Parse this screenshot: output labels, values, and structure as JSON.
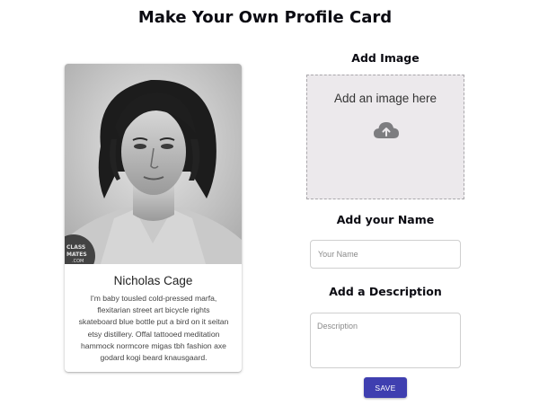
{
  "page": {
    "title": "Make Your Own Profile Card"
  },
  "card": {
    "photo_alt": "Profile photo",
    "photo_watermark": "CLASSMATES.COM",
    "name": "Nicholas Cage",
    "description": "I'm baby tousled cold-pressed marfa, flexitarian street art bicycle rights skateboard blue bottle put a bird on it seitan etsy distillery. Offal tattooed meditation hammock normcore migas tbh fashion axe godard kogi beard knausgaard."
  },
  "image_section": {
    "heading": "Add Image",
    "dropzone_text": "Add an image here",
    "icon": "cloud-upload-icon"
  },
  "name_section": {
    "heading": "Add your Name",
    "placeholder": "Your Name",
    "value": ""
  },
  "description_section": {
    "heading": "Add a Description",
    "placeholder": "Description",
    "value": ""
  },
  "actions": {
    "save_label": "SAVE"
  },
  "colors": {
    "primary_button": "#3f3fb0",
    "dropzone_bg": "#ece9ec",
    "dropzone_border": "#a9a7ab"
  }
}
